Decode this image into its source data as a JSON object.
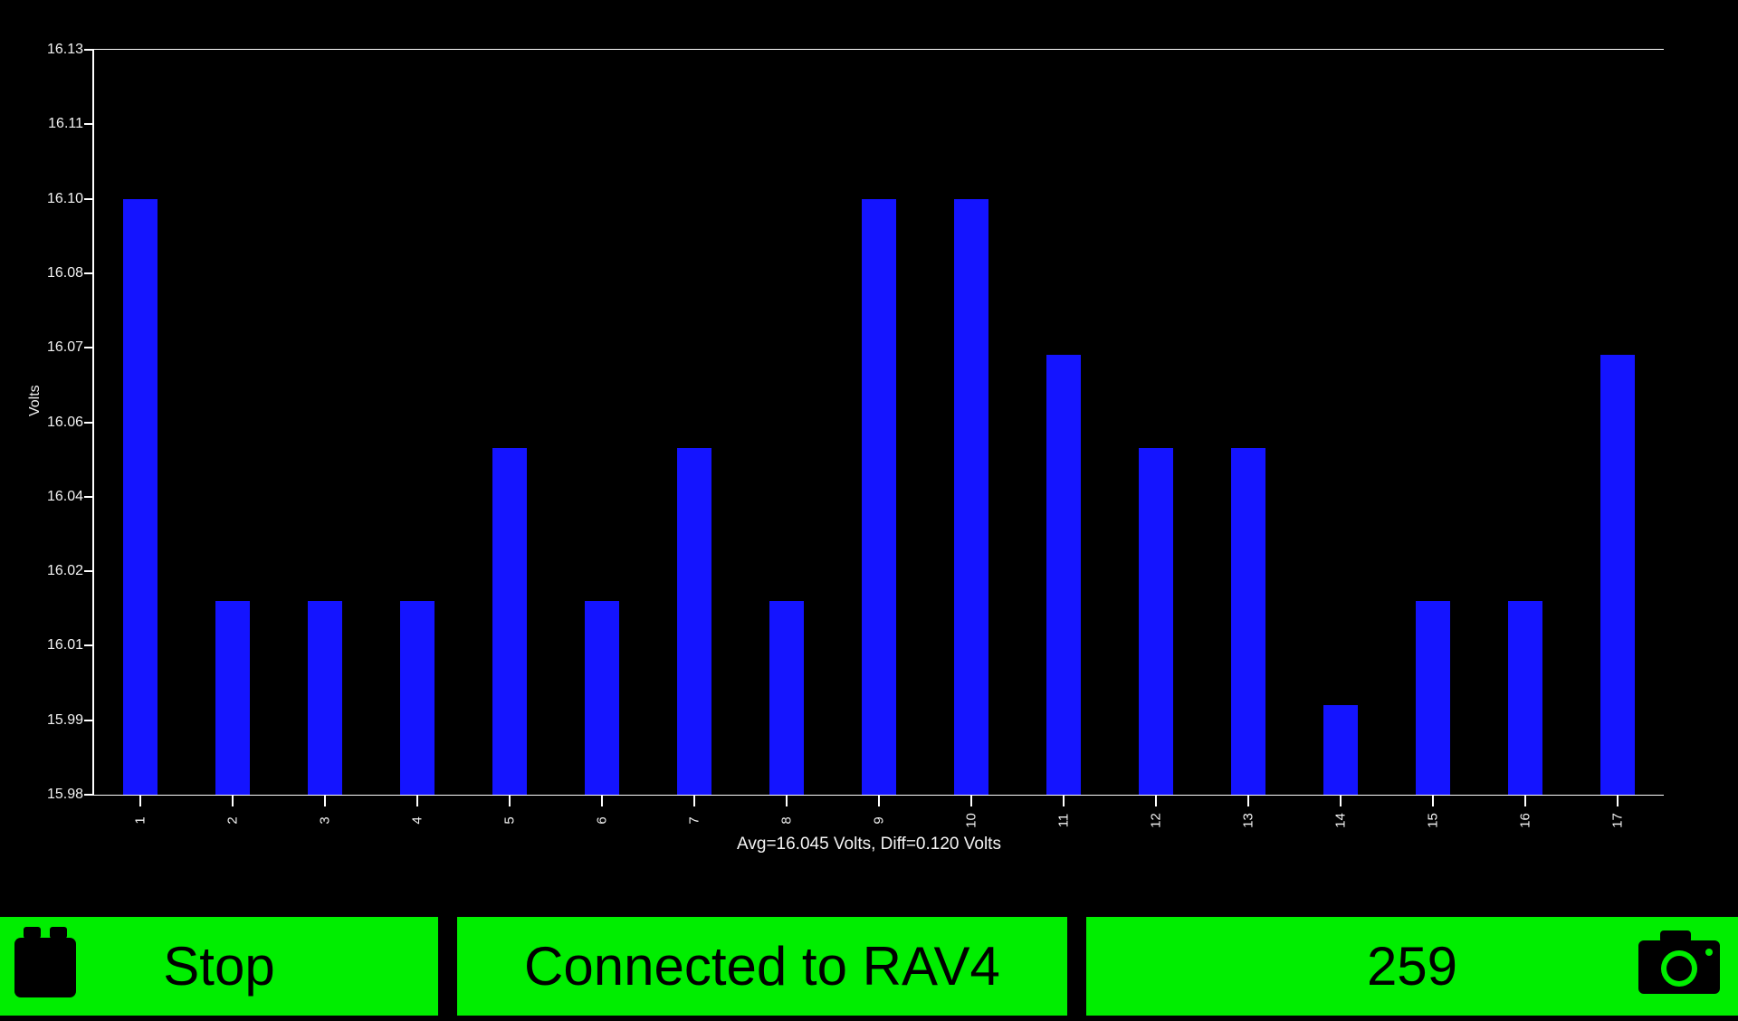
{
  "chart_data": {
    "type": "bar",
    "title": "",
    "xlabel": "",
    "ylabel": "Volts",
    "annotation": "Avg=16.045 Volts, Diff=0.120 Volts",
    "ylim": [
      15.98,
      16.13
    ],
    "grid": true,
    "legend": "none",
    "bar_color": "#1414ff",
    "background_color": "#000000",
    "axis_color": "#ffffff",
    "ytick_labels": [
      "16.13",
      "16.11",
      "16.10",
      "16.08",
      "16.07",
      "16.06",
      "16.04",
      "16.02",
      "16.01",
      "15.99",
      "15.98"
    ],
    "ytick_values": [
      16.13,
      16.11,
      16.1,
      16.08,
      16.07,
      16.06,
      16.04,
      16.02,
      16.01,
      15.99,
      15.98
    ],
    "categories": [
      "1",
      "2",
      "3",
      "4",
      "5",
      "6",
      "7",
      "8",
      "9",
      "10",
      "11",
      "12",
      "13",
      "14",
      "15",
      "16",
      "17"
    ],
    "values": [
      16.1,
      16.016,
      16.016,
      16.016,
      16.053,
      16.016,
      16.053,
      16.016,
      16.1,
      16.1,
      16.069,
      16.053,
      16.053,
      15.994,
      16.016,
      16.016,
      16.069
    ],
    "units": "Volts",
    "stats": {
      "avg": "16.045",
      "diff": "0.120"
    }
  },
  "toolbar": {
    "battery_icon": "battery-icon",
    "stop_label": "Stop",
    "status_label": "Connected to RAV4",
    "count_label": "259",
    "camera_icon": "camera-icon",
    "button_color": "#00ee00",
    "text_color": "#000000"
  }
}
